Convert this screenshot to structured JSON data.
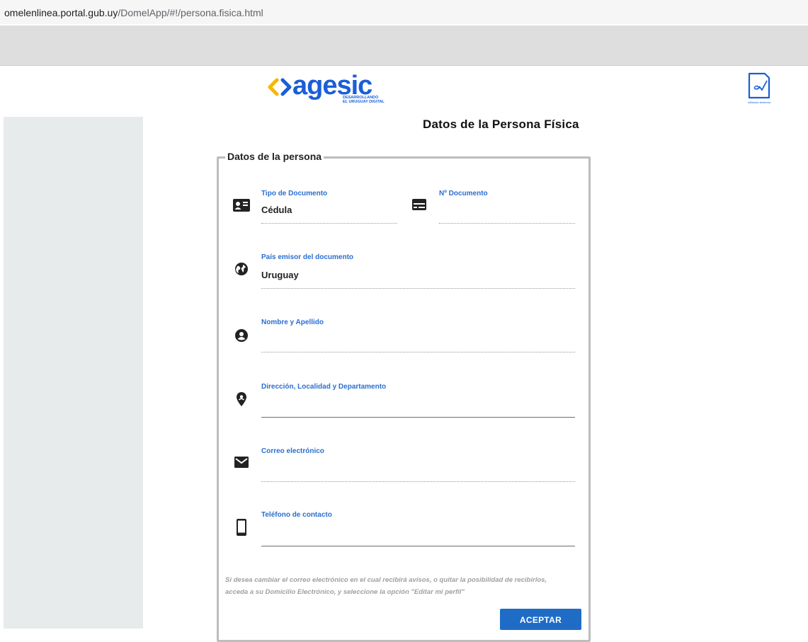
{
  "browser": {
    "url_host": "omelenlinea.portal.gub.uy",
    "url_path": "/DomelApp/#!/persona.fisica.html"
  },
  "header": {
    "logo_text": "agesic",
    "logo_tagline_1": "DESARROLLANDO",
    "logo_tagline_2": "EL URUGUAY DIGITAL",
    "notif_icon_caption": "notificación electrónica"
  },
  "page": {
    "title": "Datos de la Persona Física"
  },
  "form": {
    "legend": "Datos de la persona",
    "tipo_documento": {
      "label": "Tipo de Documento",
      "value": "Cédula"
    },
    "numero_documento": {
      "label": "Nº Documento",
      "value": ""
    },
    "pais_emisor": {
      "label": "País emisor del documento",
      "value": "Uruguay"
    },
    "nombre": {
      "label": "Nombre y Apellido",
      "value": ""
    },
    "direccion": {
      "label": "Dirección, Localidad y Departamento",
      "value": ""
    },
    "correo": {
      "label": "Correo electrónico",
      "value": ""
    },
    "telefono": {
      "label": "Teléfono de contacto",
      "value": ""
    },
    "note": "Si desea cambiar el correo electrónico en el cual recibirá avisos, o quitar la posibilidad de recibirlos, acceda a su Domicilio Electrónico, y seleccione la opción \"Editar mi perfil\"",
    "accept_label": "ACEPTAR"
  },
  "colors": {
    "accent": "#1f6cc7",
    "label_blue": "#2a6ed1",
    "logo_yellow": "#f5b800",
    "logo_blue": "#1a5ed8"
  },
  "icons": [
    "id-card-icon",
    "document-number-icon",
    "globe-icon",
    "account-circle-icon",
    "location-pin-icon",
    "mail-icon",
    "phone-icon",
    "notification-doc-icon"
  ]
}
